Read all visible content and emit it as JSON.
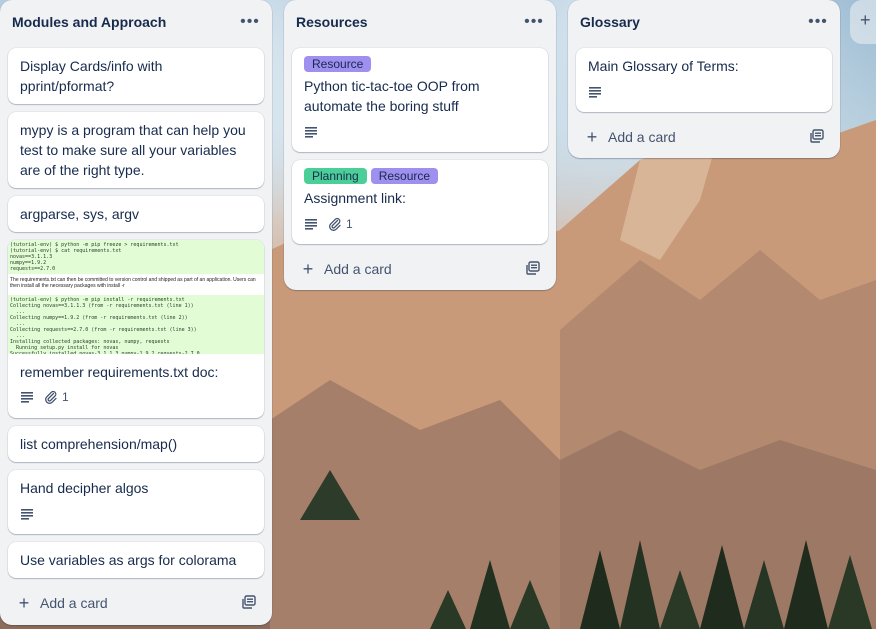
{
  "lists": [
    {
      "title": "Modules and Approach",
      "cards": [
        {
          "text": "Display Cards/info with pprint/pformat?"
        },
        {
          "text": "mypy is a program that can help you test to make sure all your variables are of the right type."
        },
        {
          "text": "argparse, sys, argv"
        },
        {
          "text": "remember requirements.txt doc:",
          "attachments": "1",
          "code_top": "(tutorial-env) $ python -m pip freeze > requirements.txt\n(tutorial-env) $ cat requirements.txt\nnovas==3.1.1.3\nnumpy==1.9.2\nrequests==2.7.0",
          "code_mid": "The requirements.txt can then be committed to version control and shipped as part of an application. Users can then install all the necessary packages with install -r",
          "code_bottom": "(tutorial-env) $ python -m pip install -r requirements.txt\nCollecting novas==3.1.1.3 (from -r requirements.txt (line 1))\n  ...\nCollecting numpy==1.9.2 (from -r requirements.txt (line 2))\n  ...\nCollecting requests==2.7.0 (from -r requirements.txt (line 3))\n  ...\nInstalling collected packages: novas, numpy, requests\n  Running setup.py install for novas\nSuccessfully installed novas-3.1.1.3 numpy-1.9.2 requests-2.7.0"
        },
        {
          "text": "list comprehension/map()"
        },
        {
          "text": "Hand decipher algos"
        },
        {
          "text": "Use variables as args for colorama"
        }
      ],
      "add_card": "Add a card"
    },
    {
      "title": "Resources",
      "cards": [
        {
          "labels": [
            "Resource"
          ],
          "text": "Python tic-tac-toe OOP from automate the boring stuff"
        },
        {
          "labels": [
            "Planning",
            "Resource"
          ],
          "text": "Assignment link:",
          "attachments": "1"
        }
      ],
      "add_card": "Add a card"
    },
    {
      "title": "Glossary",
      "cards": [
        {
          "text": "Main Glossary of Terms:"
        }
      ],
      "add_card": "Add a card"
    }
  ],
  "icons": {
    "menu": "ellipsis-icon",
    "description": "description-icon",
    "attachment": "paperclip-icon",
    "add": "plus-icon",
    "template": "card-template-icon"
  },
  "colors": {
    "list_bg": "#f1f2f4",
    "label_resource": "#9f8fef",
    "label_planning": "#4bce97",
    "text": "#172b4d"
  }
}
